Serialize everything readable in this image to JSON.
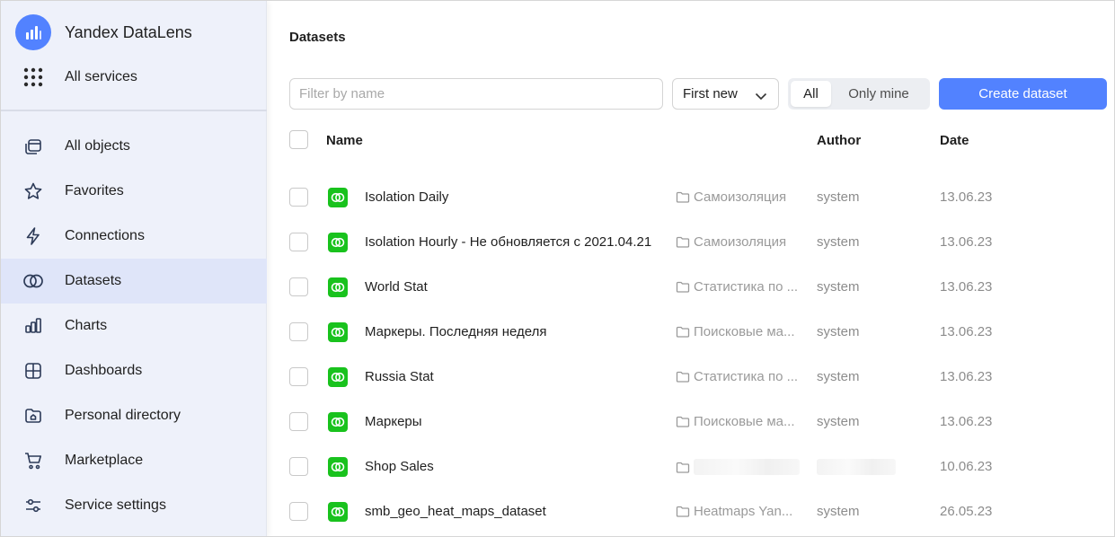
{
  "app": {
    "name": "Yandex DataLens",
    "brand_color": "#5282ff"
  },
  "sidebar": {
    "all_services": "All services",
    "items": [
      {
        "label": "All objects",
        "icon": "stack-icon",
        "active": false
      },
      {
        "label": "Favorites",
        "icon": "star-icon",
        "active": false
      },
      {
        "label": "Connections",
        "icon": "lightning-icon",
        "active": false
      },
      {
        "label": "Datasets",
        "icon": "datasets-icon",
        "active": true
      },
      {
        "label": "Charts",
        "icon": "chart-icon",
        "active": false
      },
      {
        "label": "Dashboards",
        "icon": "dashboard-icon",
        "active": false
      },
      {
        "label": "Personal directory",
        "icon": "home-folder-icon",
        "active": false
      },
      {
        "label": "Marketplace",
        "icon": "cart-icon",
        "active": false
      },
      {
        "label": "Service settings",
        "icon": "sliders-icon",
        "active": false
      }
    ]
  },
  "main": {
    "title": "Datasets",
    "filter_placeholder": "Filter by name",
    "filter_value": "",
    "sort_selected": "First new",
    "scope": {
      "all": "All",
      "mine": "Only mine",
      "selected": "All"
    },
    "create_button": "Create dataset",
    "columns": {
      "name": "Name",
      "author": "Author",
      "date": "Date"
    },
    "rows": [
      {
        "name": "Isolation Daily",
        "folder": "Самоизоляция",
        "author": "system",
        "date": "13.06.23"
      },
      {
        "name": "Isolation Hourly - Не обновляется с 2021.04.21",
        "folder": "Самоизоляция",
        "author": "system",
        "date": "13.06.23"
      },
      {
        "name": "World Stat",
        "folder": "Статистика по ...",
        "author": "system",
        "date": "13.06.23"
      },
      {
        "name": "Маркеры. Последняя неделя",
        "folder": "Поисковые ма...",
        "author": "system",
        "date": "13.06.23"
      },
      {
        "name": "Russia Stat",
        "folder": "Статистика по ...",
        "author": "system",
        "date": "13.06.23"
      },
      {
        "name": "Маркеры",
        "folder": "Поисковые ма...",
        "author": "system",
        "date": "13.06.23"
      },
      {
        "name": "Shop Sales",
        "folder": "",
        "author": "",
        "date": "10.06.23",
        "redacted": true
      },
      {
        "name": "smb_geo_heat_maps_dataset",
        "folder": "Heatmaps Yan...",
        "author": "system",
        "date": "26.05.23"
      }
    ],
    "dataset_icon_color": "#19c21d"
  }
}
